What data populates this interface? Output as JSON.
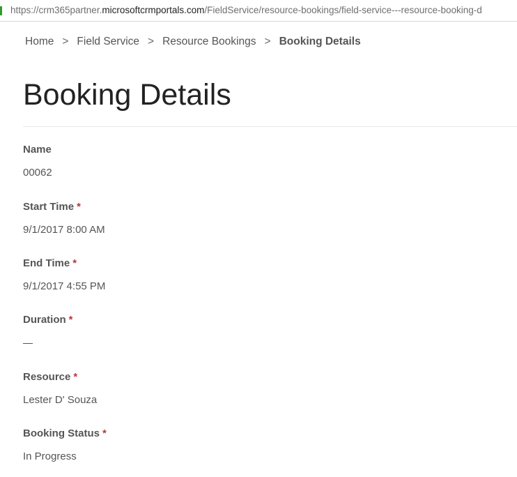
{
  "browser": {
    "url_prefix": "https://crm365partner.",
    "url_domain": "microsoftcrmportals.com",
    "url_path": "/FieldService/resource-bookings/field-service---resource-booking-d"
  },
  "breadcrumb": {
    "home": "Home",
    "field_service": "Field Service",
    "resource_bookings": "Resource Bookings",
    "current": "Booking Details",
    "separator": ">"
  },
  "page": {
    "title": "Booking Details"
  },
  "fields": {
    "name": {
      "label": "Name",
      "value": "00062"
    },
    "start_time": {
      "label": "Start Time",
      "required": "*",
      "value": "9/1/2017 8:00 AM"
    },
    "end_time": {
      "label": "End Time",
      "required": "*",
      "value": "9/1/2017 4:55 PM"
    },
    "duration": {
      "label": "Duration",
      "required": "*",
      "value": ""
    },
    "resource": {
      "label": "Resource",
      "required": "*",
      "value": "Lester D' Souza"
    },
    "booking_status": {
      "label": "Booking Status",
      "required": "*",
      "value": "In Progress"
    }
  },
  "colors": {
    "required_marker": "#b33a3a",
    "text": "#555555",
    "title": "#222222"
  }
}
